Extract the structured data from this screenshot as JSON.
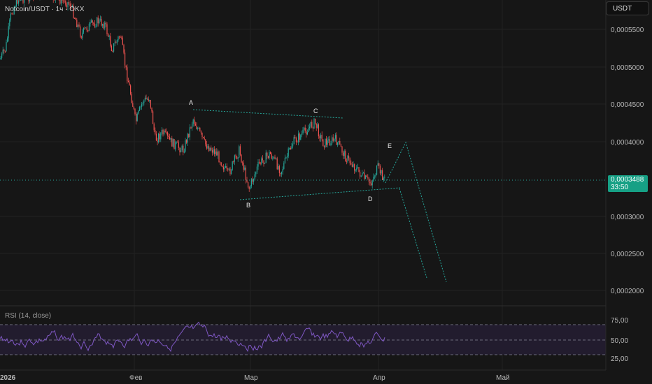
{
  "header": {
    "title": "Notcoin/USDT · 1ч · OKX",
    "currency_button": "USDT"
  },
  "price_axis": {
    "labels": [
      "0,0005500",
      "0,0005000",
      "0,0004500",
      "0,0004000",
      "0,0003000",
      "0,0002500",
      "0,0002000"
    ]
  },
  "last_price": {
    "value": "0,0003488",
    "countdown": "33:50"
  },
  "time_axis": {
    "labels": [
      "2026",
      "Фев",
      "Мар",
      "Апр",
      "Май"
    ]
  },
  "waves": {
    "labels": [
      "A",
      "B",
      "C",
      "D",
      "E"
    ]
  },
  "rsi": {
    "title": "RSI (14, close)",
    "levels": [
      "75,00",
      "50,00",
      "25,00"
    ]
  },
  "colors": {
    "up": "#26a69a",
    "down": "#ef5350",
    "rsi_line": "#7e57c2",
    "projection": "#26a69a",
    "price_tag": "#16a085"
  }
}
